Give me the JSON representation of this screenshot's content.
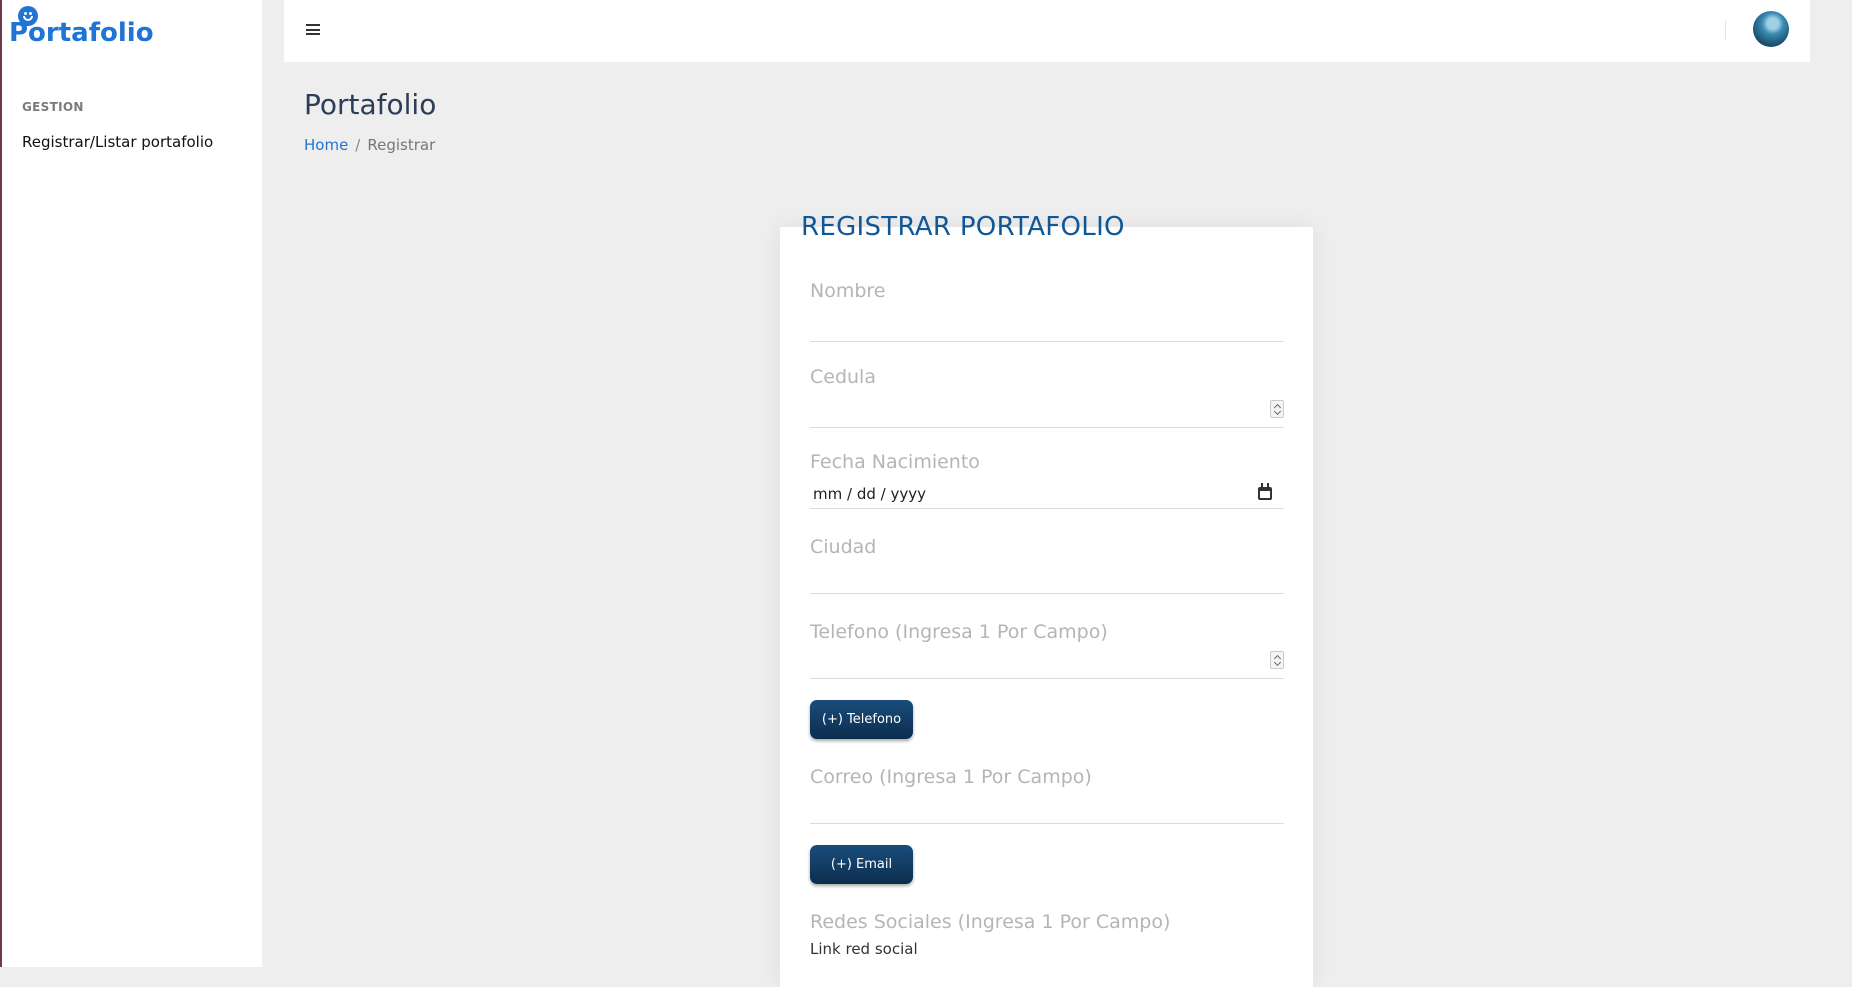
{
  "app": {
    "brand": "Portafolio"
  },
  "sidebar": {
    "heading": "GESTION",
    "items": [
      {
        "label": "Registrar/Listar portafolio"
      }
    ]
  },
  "header": {
    "menu_icon": "hamburger-menu-icon",
    "avatar_icon": "user-avatar"
  },
  "page": {
    "title": "Portafolio",
    "breadcrumb": {
      "home": "Home",
      "separator": "/",
      "current": "Registrar"
    }
  },
  "form": {
    "title": "REGISTRAR PORTAFOLIO",
    "fields": {
      "nombre": {
        "label": "Nombre",
        "value": ""
      },
      "cedula": {
        "label": "Cedula",
        "value": ""
      },
      "fecha": {
        "label": "Fecha Nacimiento",
        "placeholder": "mm / dd / yyyy"
      },
      "ciudad": {
        "label": "Ciudad",
        "value": ""
      },
      "telefono": {
        "label": "Telefono (Ingresa 1 Por Campo)",
        "value": ""
      },
      "correo": {
        "label": "Correo (Ingresa 1 Por Campo)",
        "value": ""
      },
      "redes": {
        "label": "Redes Sociales (Ingresa 1 Por Campo)",
        "sub_label": "Link red social"
      }
    },
    "buttons": {
      "add_phone": "(+) Telefono",
      "add_email": "(+) Email"
    }
  },
  "colors": {
    "brand": "#1f74d4",
    "title_blue": "#0f5797",
    "button_dark": "#0c2d4e",
    "background": "#eeeeee"
  }
}
